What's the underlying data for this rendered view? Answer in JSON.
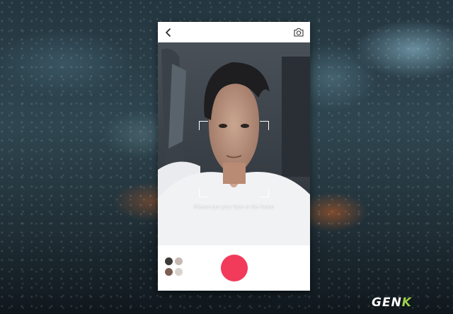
{
  "viewfinder": {
    "hint_text": "Please put your face in the frame"
  },
  "watermark": {
    "logo_main": "GEN",
    "logo_accent": "K"
  },
  "icons": {
    "back": "chevron-left-icon",
    "switch_camera": "camera-switch-icon",
    "shutter": "record-button",
    "gallery": "face-gallery-icon"
  },
  "colors": {
    "shutter": "#f23a5b",
    "bar_background": "#ffffff",
    "logo_accent": "#9ccf4b"
  }
}
